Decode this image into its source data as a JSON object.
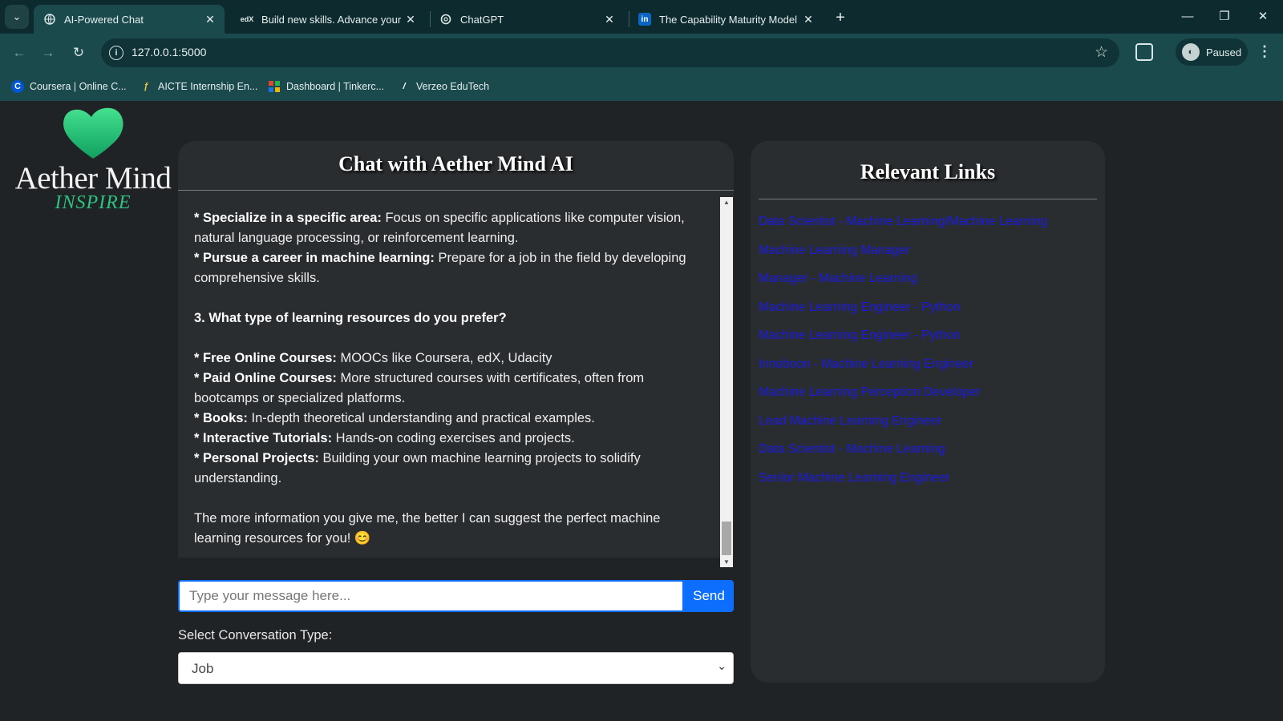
{
  "browser": {
    "tabs": [
      {
        "title": "AI-Powered Chat",
        "icon": "globe-icon",
        "active": true
      },
      {
        "title": "Build new skills. Advance your c",
        "icon": "edx-icon",
        "active": false
      },
      {
        "title": "ChatGPT",
        "icon": "chatgpt-icon",
        "active": false
      },
      {
        "title": "The Capability Maturity Model (",
        "icon": "linkedin-icon",
        "active": false
      }
    ],
    "url": "127.0.0.1:5000",
    "profile_label": "Paused",
    "bookmarks": [
      {
        "label": "Coursera | Online C...",
        "icon": "coursera-icon"
      },
      {
        "label": "AICTE Internship En...",
        "icon": "aicte-icon"
      },
      {
        "label": "Dashboard | Tinkerc...",
        "icon": "tinkercad-icon"
      },
      {
        "label": "Verzeo EduTech",
        "icon": "verzeo-icon"
      }
    ]
  },
  "logo": {
    "name": "Aether Mind",
    "tagline": "INSPIRE",
    "accent_color": "#2ec27e"
  },
  "chat": {
    "title": "Chat with Aether Mind AI",
    "messages": [
      {
        "bold": "* Specialize in a specific area:",
        "text": " Focus on specific applications like computer vision, natural language processing, or reinforcement learning."
      },
      {
        "bold": "* Pursue a career in machine learning:",
        "text": " Prepare for a job in the field by developing comprehensive skills."
      },
      {
        "bold": "3. What type of learning resources do you prefer?",
        "text": ""
      },
      {
        "bold": "* Free Online Courses:",
        "text": " MOOCs like Coursera, edX, Udacity"
      },
      {
        "bold": "* Paid Online Courses:",
        "text": " More structured courses with certificates, often from bootcamps or specialized platforms."
      },
      {
        "bold": "* Books:",
        "text": " In-depth theoretical understanding and practical examples."
      },
      {
        "bold": "* Interactive Tutorials:",
        "text": " Hands-on coding exercises and projects."
      },
      {
        "bold": "* Personal Projects:",
        "text": " Building your own machine learning projects to solidify understanding."
      },
      {
        "bold": "",
        "text": "The more information you give me, the better I can suggest the perfect machine learning resources for you! 😊"
      }
    ],
    "input_placeholder": "Type your message here...",
    "send_label": "Send",
    "select_label": "Select Conversation Type:",
    "select_value": "Job"
  },
  "links": {
    "title": "Relevant Links",
    "items": [
      "Data Scientist - Machine Learning/Machine Learning",
      "Machine Learning Manager",
      "Manager - Machine Learning",
      "Machine Learning Engineer - Python",
      "Machine Learning Engineer - Python",
      "Innoboon - Machine Learning Engineer",
      "Machine Learning Perception Developer",
      "Lead Machine Learning Engineer",
      "Data Scientist - Machine Learning",
      "Senior Machine Learning Engineer"
    ],
    "link_color": "#1a1ae6"
  },
  "colors": {
    "tabbar": "#0d2b2e",
    "toolbar": "#1b4a4d",
    "page_bg": "#202326",
    "card_bg": "#2a2d30",
    "primary": "#0d6efd"
  }
}
